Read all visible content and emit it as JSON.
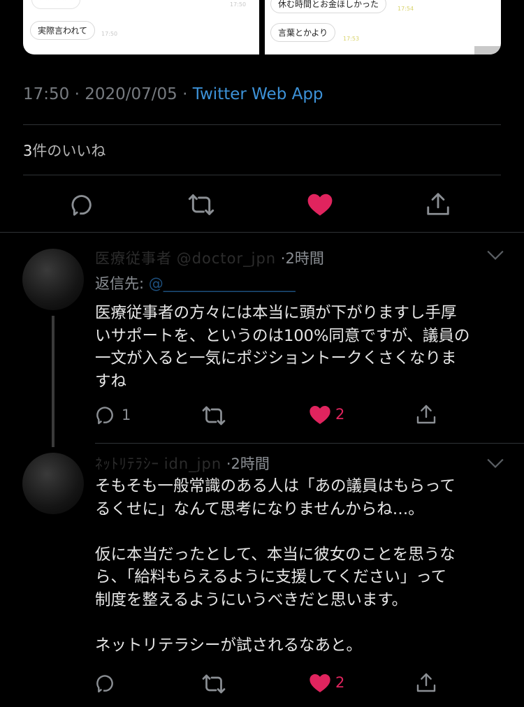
{
  "media": {
    "left_bubbles": [
      "実際言われて"
    ],
    "left_time": "17:50",
    "right_bubbles": [
      "休む時間とお金ほしかった",
      "言葉とかより"
    ],
    "right_time_top": "17:54",
    "right_time": "17:53"
  },
  "tweet": {
    "time": "17:50",
    "separator": " · ",
    "date": "2020/07/05",
    "app": "Twitter Web App",
    "likes_count": "3",
    "likes_label": "件のいいね"
  },
  "replies": [
    {
      "name": "医療従事者",
      "handle_fragment": "@doctor_jpn",
      "time": "2時間",
      "reply_to_label": "返信先:",
      "reply_to_handle": "@__________________",
      "text": "医療従事者の方々には本当に頭が下がりますし手厚\nいサポートを、というのは100%同意ですが、議員の\n一文が入ると一気にポジショントークくさくなりま\nすね",
      "reply_count": "1",
      "like_count": "2"
    },
    {
      "name": "ﾈｯﾄﾘﾃﾗｼｰ",
      "handle_fragment": "idn_jpn",
      "time": "2時間",
      "text": "そもそも一般常識のある人は「あの議員はもらって\nるくせに」なんて思考になりませんからね…。\n\n仮に本当だったとして、本当に彼女のことを思うな\nら、「給料もらえるように支援してください」って\n制度を整えるようにいうべきだと思います。\n\nネットリテラシーが試されるなあと。",
      "reply_count": "",
      "like_count": "2"
    }
  ],
  "colors": {
    "background": "#000000",
    "link": "#3d92d8",
    "like": "#e0245e",
    "secondary_text": "#8b8f94"
  },
  "icons": [
    "reply-icon",
    "retweet-icon",
    "heart-icon",
    "share-icon",
    "chevron-down-icon"
  ]
}
